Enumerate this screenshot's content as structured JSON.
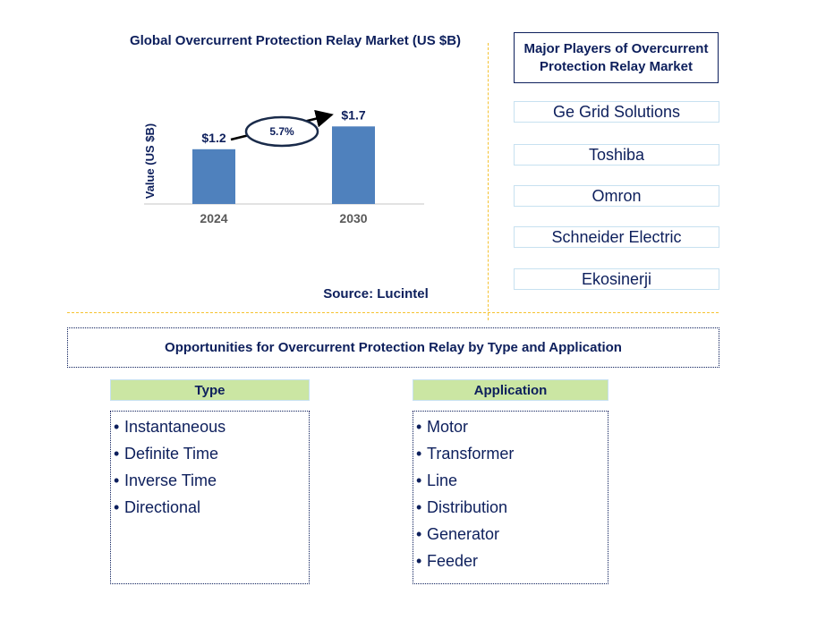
{
  "chart_data": {
    "type": "bar",
    "title": "Global Overcurrent Protection Relay Market (US $B)",
    "xlabel": "",
    "ylabel": "Value (US $B)",
    "categories": [
      "2024",
      "2030"
    ],
    "values": [
      1.2,
      1.7
    ],
    "data_labels": [
      "$1.2",
      "$1.7"
    ],
    "ylim": [
      0,
      2.0
    ],
    "grid": false,
    "annotation": {
      "type": "cagr-arrow",
      "text": "5.7%",
      "from": "2024",
      "to": "2030"
    },
    "bar_color": "#4f81bd",
    "source": "Source: Lucintel"
  },
  "players": {
    "title": "Major Players of Overcurrent Protection Relay Market",
    "items": [
      "Ge Grid Solutions",
      "Toshiba",
      "Omron",
      "Schneider Electric",
      "Ekosinerji"
    ]
  },
  "opportunities": {
    "title": "Opportunities for Overcurrent Protection Relay by Type and Application",
    "bullet": "•",
    "type": {
      "header": "Type",
      "items": [
        "Instantaneous",
        "Definite Time",
        "Inverse Time",
        "Directional"
      ]
    },
    "application": {
      "header": "Application",
      "items": [
        "Motor",
        "Transformer",
        "Line",
        "Distribution",
        "Generator",
        "Feeder"
      ]
    }
  },
  "colors": {
    "text": "#0d1f5c",
    "bar": "#4f81bd",
    "divider": "#f5c230",
    "category_header": "#cbe6a3",
    "player_border": "#c7e1f0",
    "tick_label": "#595959"
  }
}
